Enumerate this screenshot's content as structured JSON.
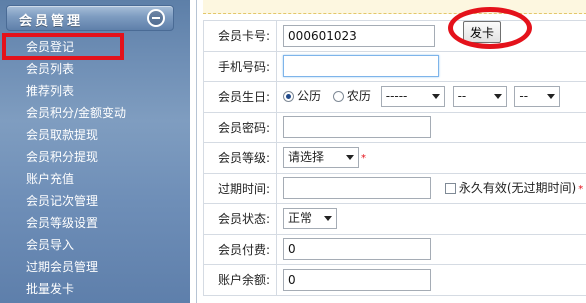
{
  "sidebar": {
    "title": "会员管理",
    "collapse_icon": "collapse-minus-icon",
    "items": [
      {
        "label": "会员登记",
        "active": true
      },
      {
        "label": "会员列表"
      },
      {
        "label": "推荐列表"
      },
      {
        "label": "会员积分/金额变动"
      },
      {
        "label": "会员取款提现"
      },
      {
        "label": "会员积分提现"
      },
      {
        "label": "账户充值"
      },
      {
        "label": "会员记次管理"
      },
      {
        "label": "会员等级设置"
      },
      {
        "label": "会员导入"
      },
      {
        "label": "过期会员管理"
      },
      {
        "label": "批量发卡"
      }
    ]
  },
  "form": {
    "card_no": {
      "label": "会员卡号:",
      "value": "000601023",
      "button": "发卡"
    },
    "phone": {
      "label": "手机号码:",
      "value": ""
    },
    "birthday": {
      "label": "会员生日:",
      "calendar_solar": "公历",
      "calendar_lunar": "农历",
      "selected": "solar",
      "year": "-----",
      "month": "--",
      "day": "--"
    },
    "password": {
      "label": "会员密码:",
      "value": ""
    },
    "level": {
      "label": "会员等级:",
      "value": "请选择",
      "required_mark": "*"
    },
    "expire": {
      "label": "过期时间:",
      "value": "",
      "never_expire": "永久有效(无过期时间)",
      "required_mark": "*"
    },
    "status": {
      "label": "会员状态:",
      "value": "正常"
    },
    "fee": {
      "label": "会员付费:",
      "value": "0"
    },
    "balance": {
      "label": "账户余额:",
      "value": "0"
    }
  },
  "annotations": {
    "color": "#e4121b"
  }
}
